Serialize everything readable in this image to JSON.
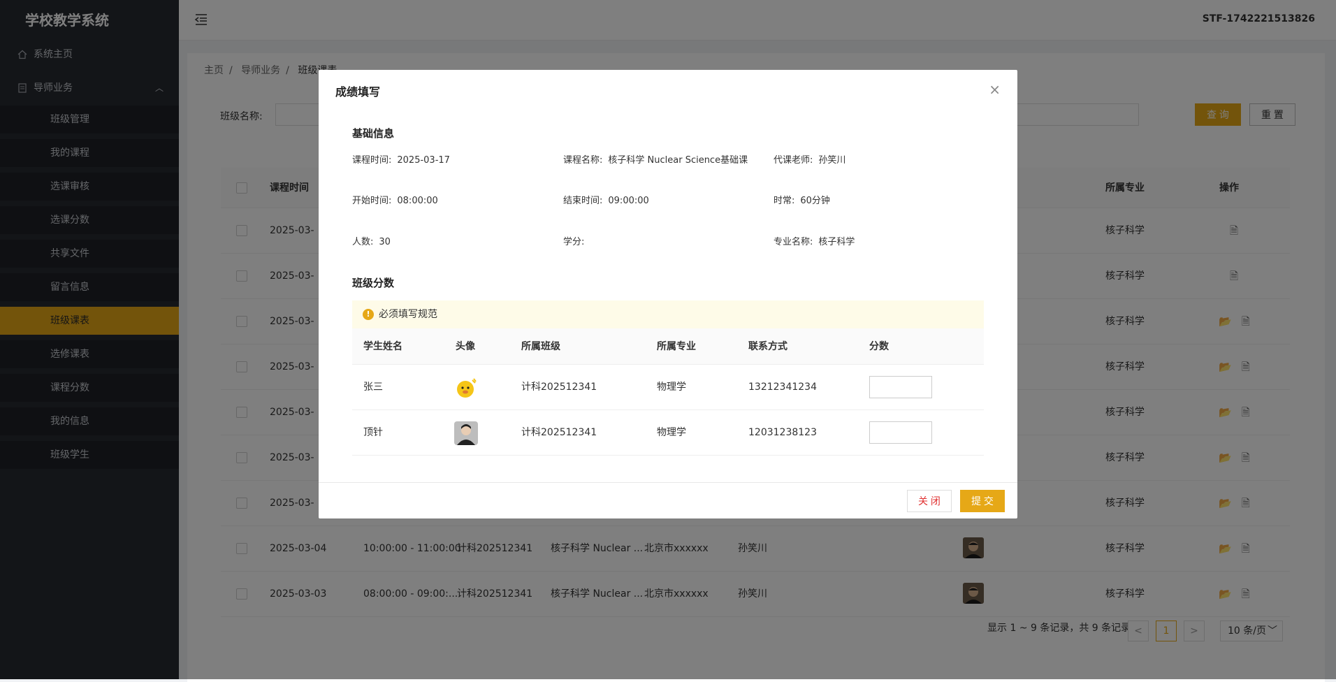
{
  "app": {
    "title": "学校教学系统",
    "user_id": "STF-1742221513826"
  },
  "sidebar": {
    "home": "系统主页",
    "group": "导师业务",
    "items": [
      "班级管理",
      "我的课程",
      "选课审核",
      "选课分数",
      "共享文件",
      "留言信息",
      "班级课表",
      "选修课表",
      "课程分数",
      "我的信息",
      "班级学生"
    ],
    "active": "班级课表"
  },
  "breadcrumb": [
    "主页",
    "导师业务",
    "班级课表"
  ],
  "filter": {
    "label": "班级名称:",
    "query": "查 询",
    "reset": "重 置"
  },
  "table": {
    "headers": {
      "date": "课程时间",
      "major": "所属专业",
      "ops": "操作"
    },
    "rows": [
      {
        "date": "2025-03-",
        "time": "",
        "class": "",
        "course": "",
        "addr": "",
        "teacher": "",
        "major": "核子科学"
      },
      {
        "date": "2025-03-",
        "time": "",
        "class": "",
        "course": "",
        "addr": "",
        "teacher": "",
        "major": "核子科学"
      },
      {
        "date": "2025-03-",
        "time": "",
        "class": "",
        "course": "",
        "addr": "",
        "teacher": "",
        "major": "核子科学"
      },
      {
        "date": "2025-03-",
        "time": "",
        "class": "",
        "course": "",
        "addr": "",
        "teacher": "",
        "major": "核子科学"
      },
      {
        "date": "2025-03-",
        "time": "",
        "class": "",
        "course": "",
        "addr": "",
        "teacher": "",
        "major": "核子科学"
      },
      {
        "date": "2025-03-",
        "time": "",
        "class": "",
        "course": "",
        "addr": "",
        "teacher": "",
        "major": "核子科学"
      },
      {
        "date": "2025-03-",
        "time": "",
        "class": "",
        "course": "",
        "addr": "",
        "teacher": "",
        "major": "核子科学"
      },
      {
        "date": "2025-03-04",
        "time": "10:00:00 - 11:00:00",
        "class": "计科202512341",
        "course": "核子科学 Nuclear ...",
        "addr": "北京市xxxxxx",
        "teacher": "孙笑川",
        "major": "核子科学"
      },
      {
        "date": "2025-03-03",
        "time": "08:00:00 - 09:00:...",
        "class": "计科202512341",
        "course": "核子科学 Nuclear ...",
        "addr": "北京市xxxxxx",
        "teacher": "孙笑川",
        "major": "核子科学"
      }
    ]
  },
  "pagination": {
    "summary": "显示 1 ~ 9 条记录，共 9 条记录",
    "prev": "<",
    "current": "1",
    "next": ">",
    "page_size": "10 条/页"
  },
  "modal": {
    "title": "成绩填写",
    "close_icon": "×",
    "basic_title": "基础信息",
    "fields": [
      {
        "k": "课程时间:",
        "v": "2025-03-17"
      },
      {
        "k": "课程名称:",
        "v": "核子科学 Nuclear Science基础课"
      },
      {
        "k": "代课老师:",
        "v": "孙笑川"
      },
      {
        "k": "开始时间:",
        "v": "08:00:00"
      },
      {
        "k": "结束时间:",
        "v": "09:00:00"
      },
      {
        "k": "时常:",
        "v": "60分钟"
      },
      {
        "k": "人数:",
        "v": "30"
      },
      {
        "k": "学分:",
        "v": ""
      },
      {
        "k": "专业名称:",
        "v": "核子科学"
      }
    ],
    "score_title": "班级分数",
    "warning": "必须填写规范",
    "warning_icon": "!",
    "student_headers": [
      "学生姓名",
      "头像",
      "所属班级",
      "所属专业",
      "联系方式",
      "分数"
    ],
    "students": [
      {
        "name": "张三",
        "class": "计科202512341",
        "major": "物理学",
        "phone": "13212341234"
      },
      {
        "name": "顶针",
        "class": "计科202512341",
        "major": "物理学",
        "phone": "12031238123"
      }
    ],
    "btn_close": "关 闭",
    "btn_submit": "提 交"
  }
}
